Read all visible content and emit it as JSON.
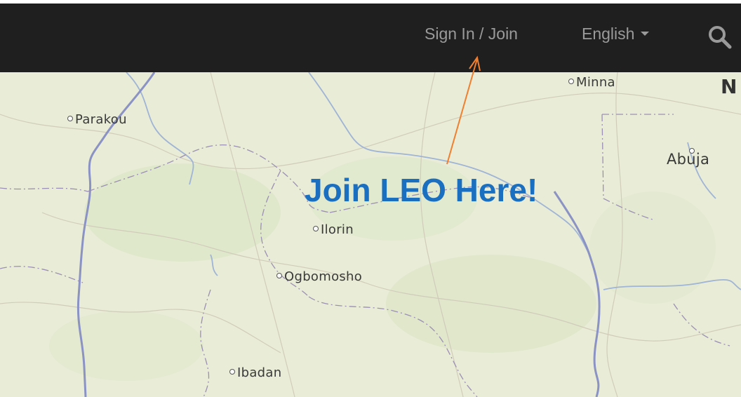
{
  "header": {
    "signin_label": "Sign In / Join",
    "language_label": "English",
    "search_icon": "search-icon"
  },
  "map": {
    "cities": [
      {
        "name": "Minna"
      },
      {
        "name": "Parakou"
      },
      {
        "name": "Abuja"
      },
      {
        "name": "Ilorin"
      },
      {
        "name": "Ogbomosho"
      },
      {
        "name": "Ibadan"
      }
    ],
    "partial_label": "N"
  },
  "annotation": {
    "callout_text": "Join LEO Here!",
    "arrow_color": "#f08030",
    "callout_color": "#1b6fc0"
  },
  "colors": {
    "navbar": "#1f1f1f",
    "nav_text": "#9a9a9a",
    "map_bg": "#e9ecd6",
    "river": "#8aa3c8",
    "border": "#7a7ab0"
  }
}
